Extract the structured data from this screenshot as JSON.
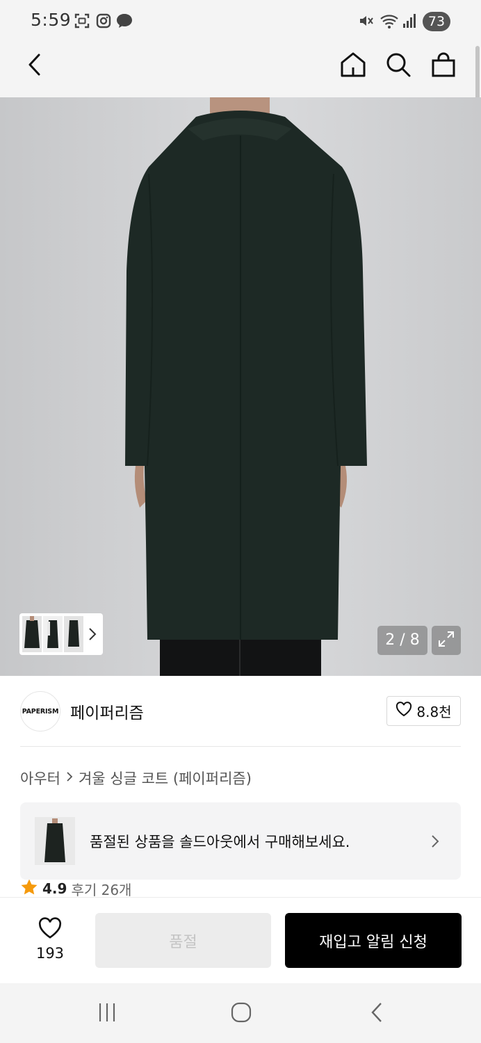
{
  "status_bar": {
    "time": "5:59",
    "battery": "73",
    "icons": [
      "screenshot-icon",
      "instagram-icon",
      "chat-bubble-icon",
      "mute-icon",
      "wifi-icon",
      "signal-icon"
    ]
  },
  "header": {
    "back_icon": "chevron-left-icon",
    "home_icon": "home-icon",
    "search_icon": "search-icon",
    "cart_icon": "shopping-bag-icon"
  },
  "gallery": {
    "page_counter": "2 / 8",
    "expand_icon": "expand-icon",
    "thumb_arrow_icon": "chevron-right-icon"
  },
  "brand": {
    "logo_text": "PAPERISM",
    "name": "페이퍼리즘",
    "like_count": "8.8천"
  },
  "breadcrumb": {
    "category": "아우터",
    "product": "겨울 싱글 코트 (페이퍼리즘)"
  },
  "soldout_banner": {
    "text": "품절된 상품을 솔드아웃에서 구매해보세요."
  },
  "rating": {
    "score": "4.9",
    "reviews": "후기 26개"
  },
  "action_bar": {
    "wish_count": "193",
    "soldout_label": "품절",
    "restock_label": "재입고 알림 신청"
  },
  "colors": {
    "coat": "#1d2925",
    "star": "#f59a0c",
    "primary_button": "#000000",
    "disabled_button": "#ececec"
  }
}
